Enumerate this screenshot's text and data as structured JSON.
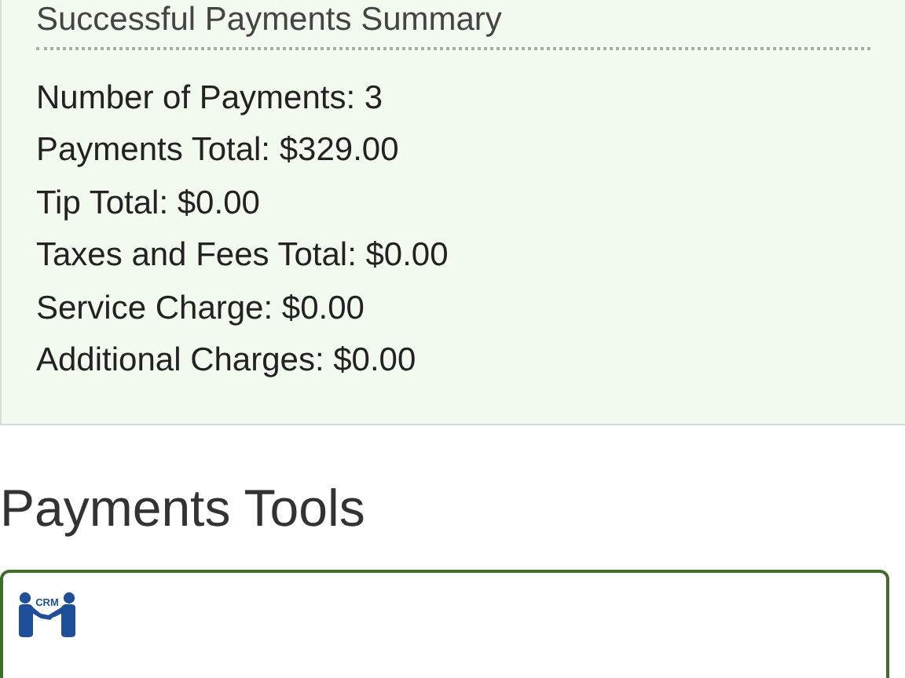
{
  "summary": {
    "title": "Successful Payments Summary",
    "lines": [
      "Number of Payments: 3",
      "Payments Total: $329.00",
      "Tip Total: $0.00",
      "Taxes and Fees Total: $0.00",
      "Service Charge: $0.00",
      "Additional Charges: $0.00"
    ]
  },
  "tools": {
    "heading": "Payments Tools",
    "cards": [
      {
        "logo_text": "CRM"
      }
    ]
  }
}
